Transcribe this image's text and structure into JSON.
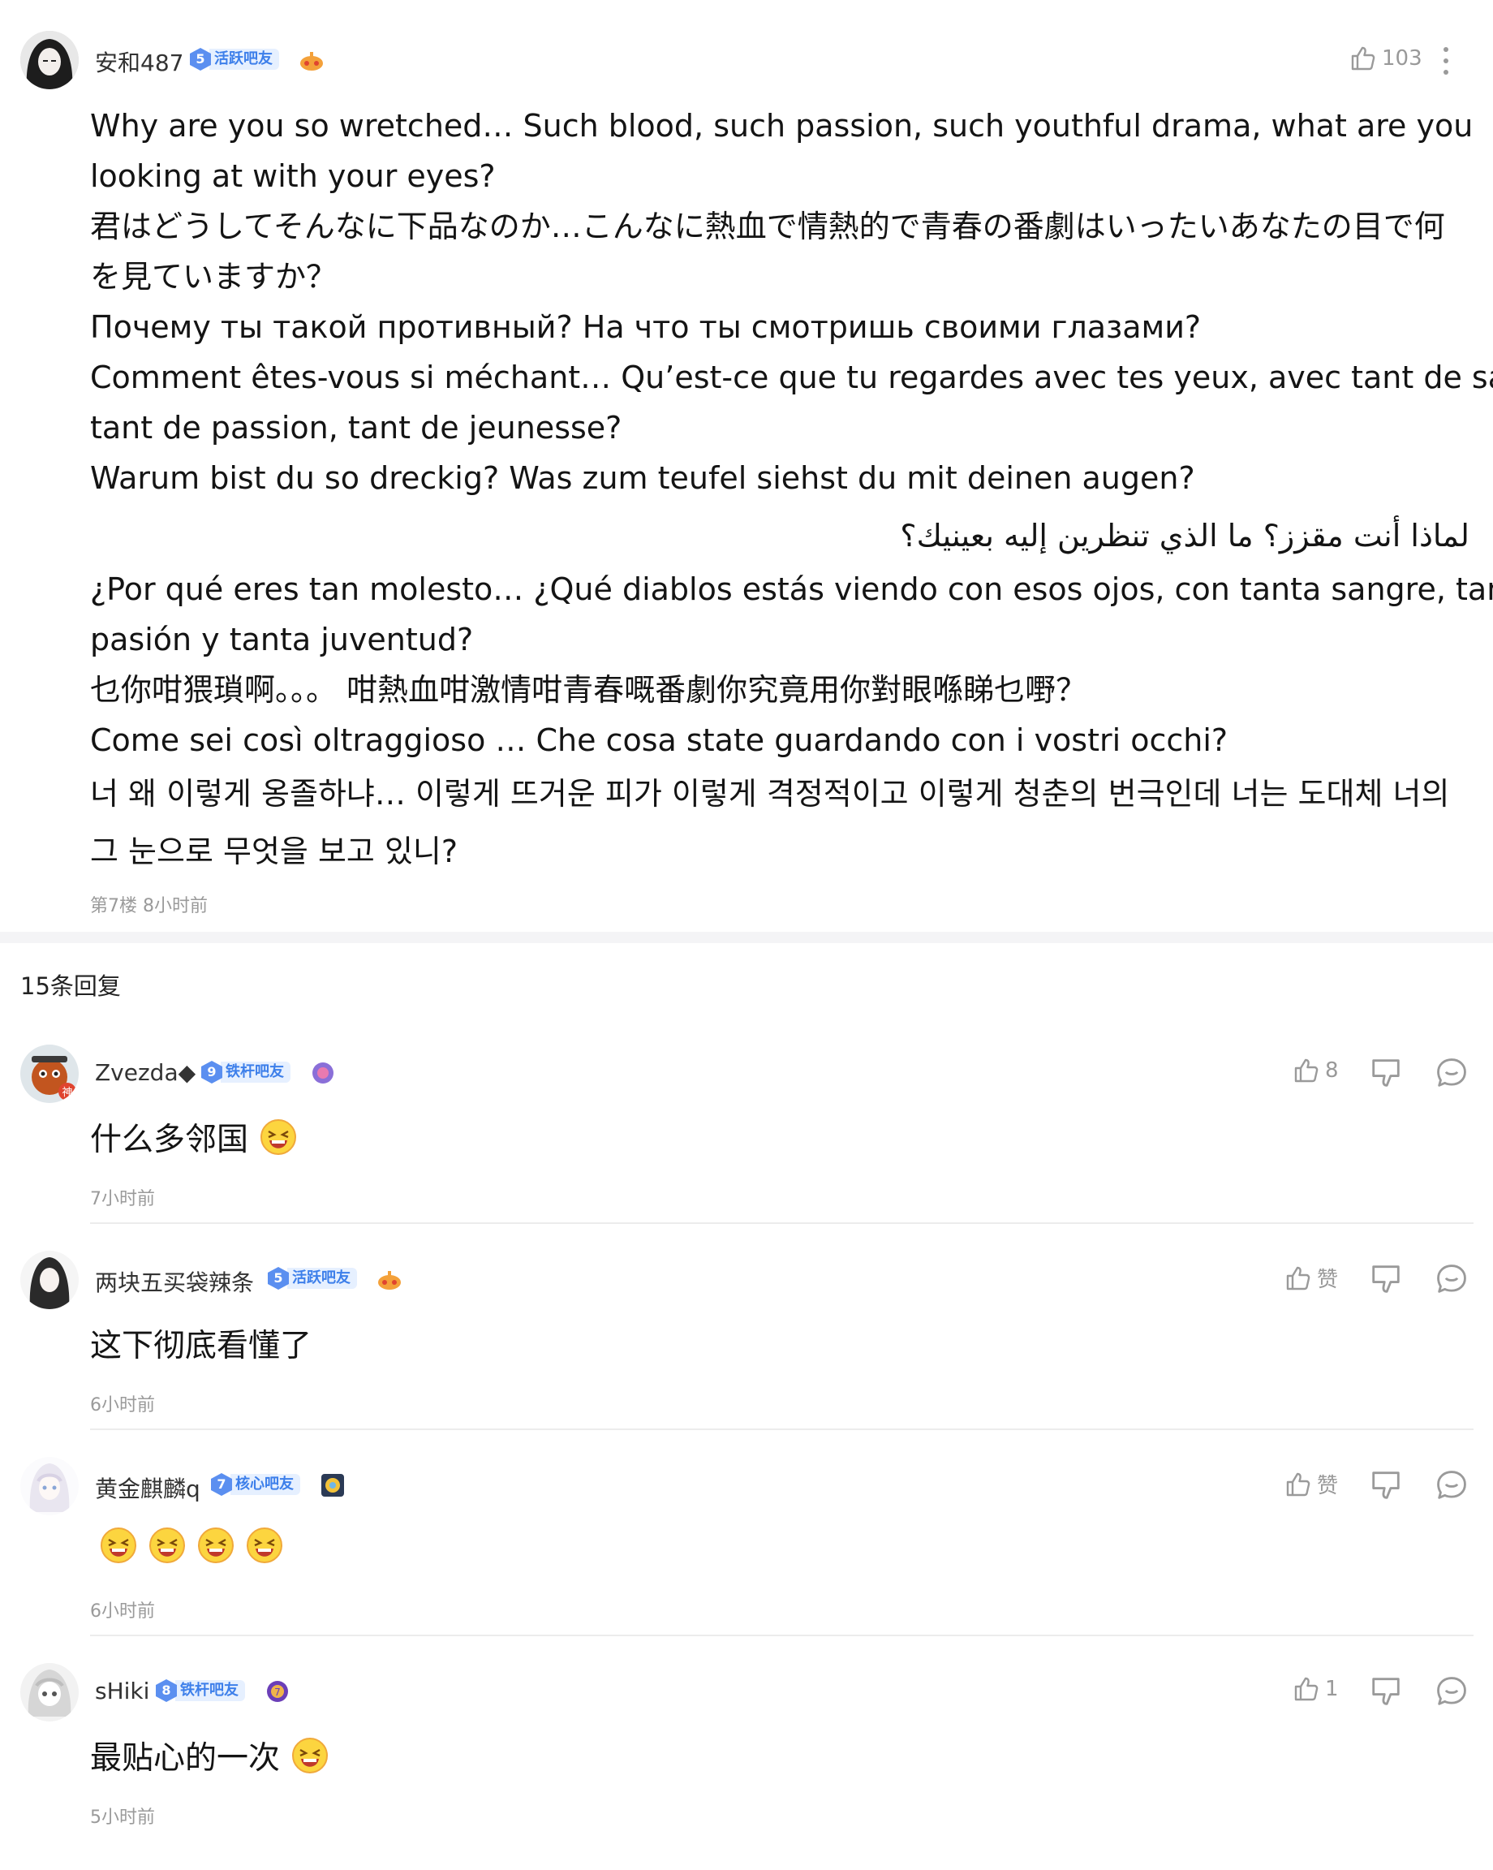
{
  "post": {
    "username": "安和487",
    "level": "5",
    "badge": "活跃吧友",
    "like_count": "103",
    "lines": [
      "Why are you so wretched… Such blood, such passion, such youthful drama, what are you",
      "looking at with your eyes?",
      "君はどうしてそんなに下品なのか…こんなに熱血で情熱的で青春の番劇はいったいあなたの目で何",
      "を見ていますか？",
      "Почему ты такой противный? На что ты смотришь своими глазами?",
      "Comment êtes-vous si méchant… Qu’est-ce que tu regardes avec tes yeux, avec tant de sang,",
      "tant de passion, tant de jeunesse?",
      "Warum bist du so dreckig? Was zum teufel siehst du mit deinen augen?"
    ],
    "arabic": "لماذا أنت مقزز؟ ما الذي تنظرين إليه بعينيك؟",
    "lines2": [
      "¿Por qué eres tan molesto… ¿Qué diablos estás viendo con esos ojos, con tanta sangre, tanta",
      "pasión y tanta juventud?",
      "乜你咁猥瑣啊。。。  咁熱血咁激情咁青春嘅番劇你究竟用你對眼喺睇乜嘢？",
      "Come sei così oltraggioso … Che cosa state guardando con i vostri occhi?"
    ],
    "korean": [
      "너 왜 이렇게 옹졸하냐… 이렇게 뜨거운 피가 이렇게 격정적이고 이렇게 청춘의 번극인데 너는 도대체 너의",
      "그 눈으로 무엇을 보고 있니?"
    ],
    "meta": "第7楼  8小时前"
  },
  "reply_count": "15条回复",
  "replies": [
    {
      "username": "Zvezda◆",
      "level": "9",
      "badge": "铁杆吧友",
      "text": "什么多邻国",
      "emoji_count": 1,
      "time": "7小时前",
      "like": "8"
    },
    {
      "username": "两块五买袋辣条",
      "level": "5",
      "badge": "活跃吧友",
      "text": "这下彻底看懂了",
      "emoji_count": 0,
      "time": "6小时前",
      "like": "赞"
    },
    {
      "username": "黄金麒麟q",
      "level": "7",
      "badge": "核心吧友",
      "text": "",
      "emoji_count": 4,
      "time": "6小时前",
      "like": "赞"
    },
    {
      "username": "sHiki",
      "level": "8",
      "badge": "铁杆吧友",
      "text": "最贴心的一次",
      "emoji_count": 1,
      "time": "5小时前",
      "like": "1"
    }
  ],
  "colors": {
    "badge_blue": "#3d7fea",
    "badge_bg": "#e6f0ff",
    "meta_gray": "#9a9a9a"
  },
  "icons": [
    "thumb-up-icon",
    "thumb-down-icon",
    "comment-icon",
    "more-vertical-icon",
    "laughing-emoji-icon"
  ]
}
